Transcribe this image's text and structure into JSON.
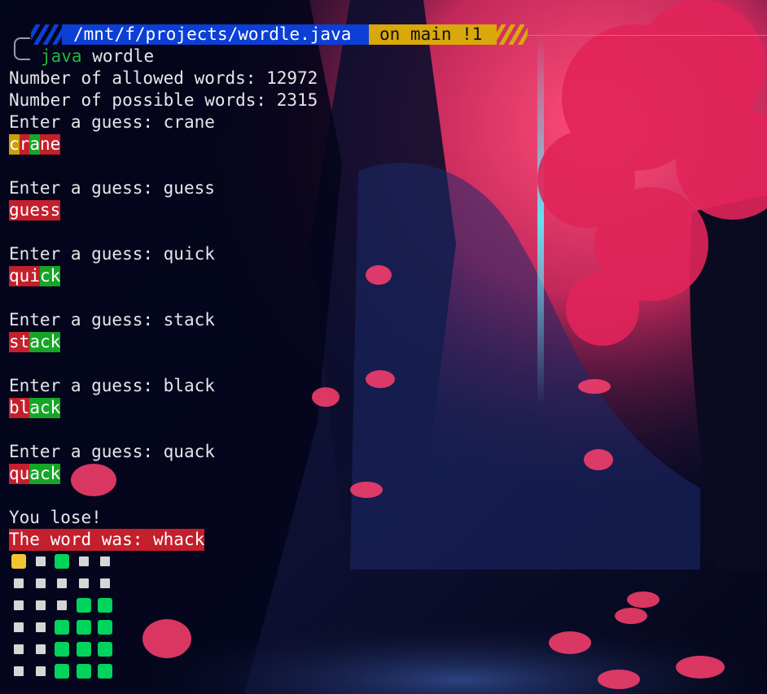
{
  "prompt": {
    "path": "/mnt/f/projects/wordle.java",
    "git": "on main !1",
    "command": "java",
    "argument": "wordle"
  },
  "output": {
    "allowed": "Number of allowed words: 12972",
    "possible": "Number of possible words: 2315",
    "guess_prompt": "Enter a guess: "
  },
  "guesses": [
    {
      "word": "crane",
      "marks": [
        "y",
        "g",
        "n",
        "g",
        "g"
      ]
    },
    {
      "word": "guess",
      "marks": [
        "g",
        "g",
        "g",
        "g",
        "g"
      ]
    },
    {
      "word": "quick",
      "marks": [
        "g",
        "g",
        "g",
        "n",
        "n"
      ]
    },
    {
      "word": "stack",
      "marks": [
        "g",
        "g",
        "n",
        "n",
        "n"
      ]
    },
    {
      "word": "black",
      "marks": [
        "g",
        "g",
        "n",
        "n",
        "n"
      ]
    },
    {
      "word": "quack",
      "marks": [
        "g",
        "g",
        "n",
        "n",
        "n"
      ]
    }
  ],
  "result": {
    "lose": "You lose!",
    "reveal": "The word was: whack"
  },
  "emoji_grid": [
    [
      "yellow",
      "white",
      "green",
      "white",
      "white"
    ],
    [
      "white",
      "white",
      "white",
      "white",
      "white"
    ],
    [
      "white",
      "white",
      "white",
      "green",
      "green"
    ],
    [
      "white",
      "white",
      "green",
      "green",
      "green"
    ],
    [
      "white",
      "white",
      "green",
      "green",
      "green"
    ],
    [
      "white",
      "white",
      "green",
      "green",
      "green"
    ]
  ],
  "colors": {
    "path_segment": "#0b3fd6",
    "git_segment": "#d9a80a",
    "tile_gray": "#c41f2c",
    "tile_yellow": "#c9a00a",
    "tile_green": "#16a626",
    "square_green": "#00d45c",
    "square_yellow": "#f3c531"
  }
}
